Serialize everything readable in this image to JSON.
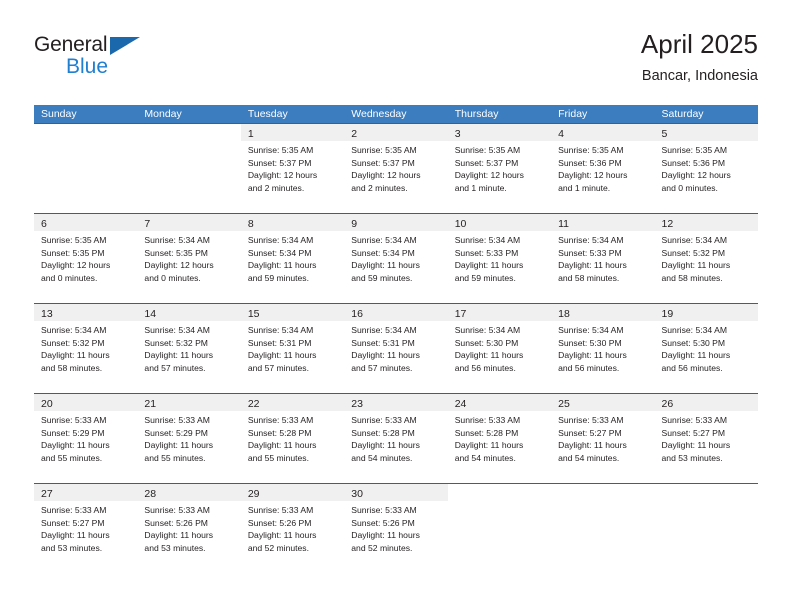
{
  "brand": {
    "name_part1": "General",
    "name_part2": "Blue",
    "logo_icon": "triangle-logo"
  },
  "header": {
    "title": "April 2025",
    "subtitle": "Bancar, Indonesia"
  },
  "calendar": {
    "weekday_headers": [
      "Sunday",
      "Monday",
      "Tuesday",
      "Wednesday",
      "Thursday",
      "Friday",
      "Saturday"
    ],
    "accent_color": "#3b7dbf",
    "rule_color": "#1b68ad",
    "daynum_strip_color": "#f0f0f0",
    "weeks": [
      [
        {
          "day": "",
          "sunrise": "",
          "sunset": "",
          "daylight_line1": "",
          "daylight_line2": ""
        },
        {
          "day": "",
          "sunrise": "",
          "sunset": "",
          "daylight_line1": "",
          "daylight_line2": ""
        },
        {
          "day": "1",
          "sunrise": "Sunrise: 5:35 AM",
          "sunset": "Sunset: 5:37 PM",
          "daylight_line1": "Daylight: 12 hours",
          "daylight_line2": "and 2 minutes."
        },
        {
          "day": "2",
          "sunrise": "Sunrise: 5:35 AM",
          "sunset": "Sunset: 5:37 PM",
          "daylight_line1": "Daylight: 12 hours",
          "daylight_line2": "and 2 minutes."
        },
        {
          "day": "3",
          "sunrise": "Sunrise: 5:35 AM",
          "sunset": "Sunset: 5:37 PM",
          "daylight_line1": "Daylight: 12 hours",
          "daylight_line2": "and 1 minute."
        },
        {
          "day": "4",
          "sunrise": "Sunrise: 5:35 AM",
          "sunset": "Sunset: 5:36 PM",
          "daylight_line1": "Daylight: 12 hours",
          "daylight_line2": "and 1 minute."
        },
        {
          "day": "5",
          "sunrise": "Sunrise: 5:35 AM",
          "sunset": "Sunset: 5:36 PM",
          "daylight_line1": "Daylight: 12 hours",
          "daylight_line2": "and 0 minutes."
        }
      ],
      [
        {
          "day": "6",
          "sunrise": "Sunrise: 5:35 AM",
          "sunset": "Sunset: 5:35 PM",
          "daylight_line1": "Daylight: 12 hours",
          "daylight_line2": "and 0 minutes."
        },
        {
          "day": "7",
          "sunrise": "Sunrise: 5:34 AM",
          "sunset": "Sunset: 5:35 PM",
          "daylight_line1": "Daylight: 12 hours",
          "daylight_line2": "and 0 minutes."
        },
        {
          "day": "8",
          "sunrise": "Sunrise: 5:34 AM",
          "sunset": "Sunset: 5:34 PM",
          "daylight_line1": "Daylight: 11 hours",
          "daylight_line2": "and 59 minutes."
        },
        {
          "day": "9",
          "sunrise": "Sunrise: 5:34 AM",
          "sunset": "Sunset: 5:34 PM",
          "daylight_line1": "Daylight: 11 hours",
          "daylight_line2": "and 59 minutes."
        },
        {
          "day": "10",
          "sunrise": "Sunrise: 5:34 AM",
          "sunset": "Sunset: 5:33 PM",
          "daylight_line1": "Daylight: 11 hours",
          "daylight_line2": "and 59 minutes."
        },
        {
          "day": "11",
          "sunrise": "Sunrise: 5:34 AM",
          "sunset": "Sunset: 5:33 PM",
          "daylight_line1": "Daylight: 11 hours",
          "daylight_line2": "and 58 minutes."
        },
        {
          "day": "12",
          "sunrise": "Sunrise: 5:34 AM",
          "sunset": "Sunset: 5:32 PM",
          "daylight_line1": "Daylight: 11 hours",
          "daylight_line2": "and 58 minutes."
        }
      ],
      [
        {
          "day": "13",
          "sunrise": "Sunrise: 5:34 AM",
          "sunset": "Sunset: 5:32 PM",
          "daylight_line1": "Daylight: 11 hours",
          "daylight_line2": "and 58 minutes."
        },
        {
          "day": "14",
          "sunrise": "Sunrise: 5:34 AM",
          "sunset": "Sunset: 5:32 PM",
          "daylight_line1": "Daylight: 11 hours",
          "daylight_line2": "and 57 minutes."
        },
        {
          "day": "15",
          "sunrise": "Sunrise: 5:34 AM",
          "sunset": "Sunset: 5:31 PM",
          "daylight_line1": "Daylight: 11 hours",
          "daylight_line2": "and 57 minutes."
        },
        {
          "day": "16",
          "sunrise": "Sunrise: 5:34 AM",
          "sunset": "Sunset: 5:31 PM",
          "daylight_line1": "Daylight: 11 hours",
          "daylight_line2": "and 57 minutes."
        },
        {
          "day": "17",
          "sunrise": "Sunrise: 5:34 AM",
          "sunset": "Sunset: 5:30 PM",
          "daylight_line1": "Daylight: 11 hours",
          "daylight_line2": "and 56 minutes."
        },
        {
          "day": "18",
          "sunrise": "Sunrise: 5:34 AM",
          "sunset": "Sunset: 5:30 PM",
          "daylight_line1": "Daylight: 11 hours",
          "daylight_line2": "and 56 minutes."
        },
        {
          "day": "19",
          "sunrise": "Sunrise: 5:34 AM",
          "sunset": "Sunset: 5:30 PM",
          "daylight_line1": "Daylight: 11 hours",
          "daylight_line2": "and 56 minutes."
        }
      ],
      [
        {
          "day": "20",
          "sunrise": "Sunrise: 5:33 AM",
          "sunset": "Sunset: 5:29 PM",
          "daylight_line1": "Daylight: 11 hours",
          "daylight_line2": "and 55 minutes."
        },
        {
          "day": "21",
          "sunrise": "Sunrise: 5:33 AM",
          "sunset": "Sunset: 5:29 PM",
          "daylight_line1": "Daylight: 11 hours",
          "daylight_line2": "and 55 minutes."
        },
        {
          "day": "22",
          "sunrise": "Sunrise: 5:33 AM",
          "sunset": "Sunset: 5:28 PM",
          "daylight_line1": "Daylight: 11 hours",
          "daylight_line2": "and 55 minutes."
        },
        {
          "day": "23",
          "sunrise": "Sunrise: 5:33 AM",
          "sunset": "Sunset: 5:28 PM",
          "daylight_line1": "Daylight: 11 hours",
          "daylight_line2": "and 54 minutes."
        },
        {
          "day": "24",
          "sunrise": "Sunrise: 5:33 AM",
          "sunset": "Sunset: 5:28 PM",
          "daylight_line1": "Daylight: 11 hours",
          "daylight_line2": "and 54 minutes."
        },
        {
          "day": "25",
          "sunrise": "Sunrise: 5:33 AM",
          "sunset": "Sunset: 5:27 PM",
          "daylight_line1": "Daylight: 11 hours",
          "daylight_line2": "and 54 minutes."
        },
        {
          "day": "26",
          "sunrise": "Sunrise: 5:33 AM",
          "sunset": "Sunset: 5:27 PM",
          "daylight_line1": "Daylight: 11 hours",
          "daylight_line2": "and 53 minutes."
        }
      ],
      [
        {
          "day": "27",
          "sunrise": "Sunrise: 5:33 AM",
          "sunset": "Sunset: 5:27 PM",
          "daylight_line1": "Daylight: 11 hours",
          "daylight_line2": "and 53 minutes."
        },
        {
          "day": "28",
          "sunrise": "Sunrise: 5:33 AM",
          "sunset": "Sunset: 5:26 PM",
          "daylight_line1": "Daylight: 11 hours",
          "daylight_line2": "and 53 minutes."
        },
        {
          "day": "29",
          "sunrise": "Sunrise: 5:33 AM",
          "sunset": "Sunset: 5:26 PM",
          "daylight_line1": "Daylight: 11 hours",
          "daylight_line2": "and 52 minutes."
        },
        {
          "day": "30",
          "sunrise": "Sunrise: 5:33 AM",
          "sunset": "Sunset: 5:26 PM",
          "daylight_line1": "Daylight: 11 hours",
          "daylight_line2": "and 52 minutes."
        },
        {
          "day": "",
          "sunrise": "",
          "sunset": "",
          "daylight_line1": "",
          "daylight_line2": ""
        },
        {
          "day": "",
          "sunrise": "",
          "sunset": "",
          "daylight_line1": "",
          "daylight_line2": ""
        },
        {
          "day": "",
          "sunrise": "",
          "sunset": "",
          "daylight_line1": "",
          "daylight_line2": ""
        }
      ]
    ]
  }
}
